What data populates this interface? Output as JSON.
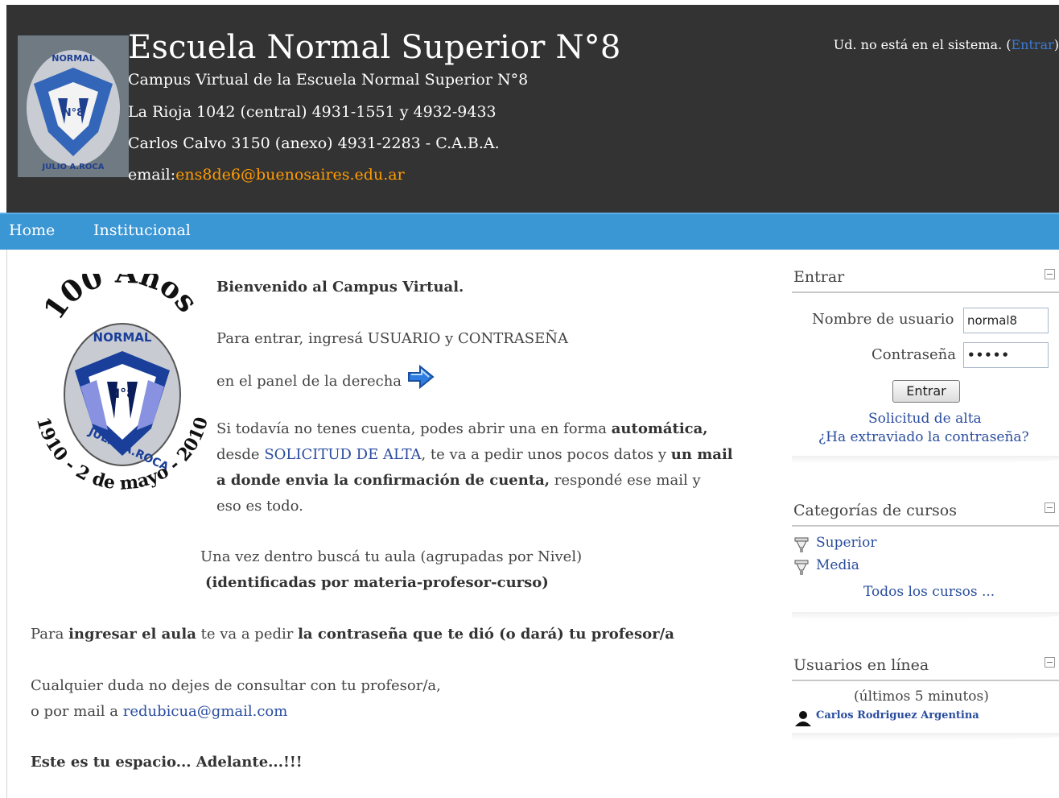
{
  "header": {
    "title": "Escuela Normal Superior N°8",
    "line1": "Campus Virtual de la Escuela Normal Superior N°8",
    "line2": "La Rioja 1042 (central) 4931-1551 y 4932-9433",
    "line3": "Carlos Calvo 3150 (anexo) 4931-2283 - C.A.B.A.",
    "email_label": "email:",
    "email": "ens8de6@buenosaires.edu.ar",
    "login_status_prefix": "Ud. no está en el sistema. (",
    "login_link": "Entrar",
    "login_status_suffix": ")"
  },
  "nav": {
    "home": "Home",
    "institucional": "Institucional"
  },
  "main": {
    "welcome": "Bienvenido al Campus Virtual.",
    "enter_line1": "Para entrar, ingresá USUARIO y CONTRASEÑA",
    "enter_line2": "en el panel de la derecha",
    "p1_a": "Si todavía no tenes cuenta, podes abrir una en forma ",
    "p1_b": "automática,",
    "p2_a": "desde ",
    "p2_link": "SOLICITUD DE ALTA",
    "p2_b": ", te va a pedir unos pocos datos y ",
    "p2_c": "un mail",
    "p3_a": "a donde envia la confirmación de cuenta,",
    "p3_b": " respondé ese mail y",
    "p4": "eso es todo.",
    "aula_line1": "Una vez dentro buscá tu aula (agrupadas por Nivel)",
    "aula_line2": "(identificadas por materia-profesor-curso)",
    "ingresar_a": "Para ",
    "ingresar_b": "ingresar el aula",
    "ingresar_c": " te va a pedir ",
    "ingresar_d": "la contraseña que te dió (o dará) tu profesor/a",
    "duda_line1": "Cualquier duda no dejes de consultar con tu profesor/a,",
    "duda_line2_a": "o por mail a ",
    "duda_email": "redubicua@gmail.com",
    "closing": "Este es tu espacio... Adelante...!!!"
  },
  "login_block": {
    "title": "Entrar",
    "username_label": "Nombre de usuario",
    "username_value": "normal8",
    "password_label": "Contraseña",
    "password_value": "•••••",
    "submit": "Entrar",
    "signup_link": "Solicitud de alta",
    "forgot_link": "¿Ha extraviado la contraseña?"
  },
  "categories_block": {
    "title": "Categorías de cursos",
    "items": [
      "Superior",
      "Media"
    ],
    "all_link": "Todos los cursos ..."
  },
  "online_block": {
    "title": "Usuarios en línea",
    "subtitle": "(últimos 5 minutos)",
    "users": [
      "Carlos Rodriguez Argentina"
    ]
  },
  "logo": {
    "shield_text_top": "NORMAL",
    "shield_text_mid": "N°8",
    "shield_text_bottom": "JULIO A.ROCA",
    "anniv_top": "100 Años",
    "anniv_bottom": "1910 - 2 de mayo - 2010"
  },
  "colors": {
    "header_bg": "#333333",
    "nav_bg": "#3b96d4",
    "email_link": "#ff9c00",
    "link": "#2a4d9e"
  }
}
